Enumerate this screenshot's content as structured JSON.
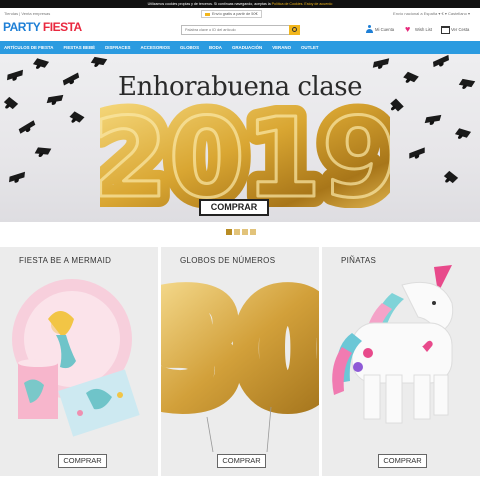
{
  "cookie": {
    "text": "Utilizamos cookies propias y de terceros. Si continuas navegando, aceptas la",
    "link": "Política de Cookies. Estoy de acuerdo"
  },
  "topbar": {
    "stores": "Tiendas | Venta empresas",
    "shipping": "Envío gratis a partir de 50€",
    "locale": "Envío nacional a  España  ▾   € ▾  Castellano ▾"
  },
  "header": {
    "logo_party": "PARTY",
    "logo_fiesta": "FIESTA",
    "search_placeholder": "Palabra clave o ID del artículo",
    "account": "Mi Cuenta",
    "wishlist": "Wish List",
    "cart": "Ver Cesta"
  },
  "nav": [
    "ARTÍCULOS DE FIESTA",
    "FIESTAS BEBÉ",
    "DISFRACES",
    "ACCESORIOS",
    "GLOBOS",
    "BODA",
    "GRADUACIÓN",
    "VERANO",
    "OUTLET"
  ],
  "hero": {
    "title": "Enhorabuena clase",
    "year": "2019",
    "button": "COMPRAR",
    "slides": 4,
    "active_slide": 1
  },
  "panels": [
    {
      "title": "FIESTA BE A MERMAID",
      "button": "COMPRAR"
    },
    {
      "title": "GLOBOS DE NÚMEROS",
      "number": "30",
      "button": "COMPRAR"
    },
    {
      "title": "PIÑATAS",
      "button": "COMPRAR"
    }
  ],
  "colors": {
    "nav_blue": "#2b9be0",
    "gold": "#d9a632",
    "logo_red": "#e9283f"
  }
}
